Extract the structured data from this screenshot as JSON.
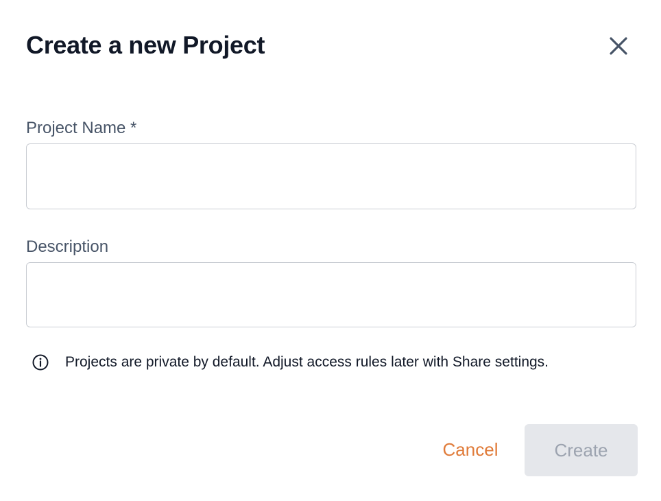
{
  "dialog": {
    "title": "Create a new Project",
    "close_icon": "close-icon"
  },
  "form": {
    "name_label": "Project Name *",
    "name_value": "",
    "description_label": "Description",
    "description_value": ""
  },
  "info": {
    "icon": "info-icon",
    "text": "Projects are private by default. Adjust access rules later with Share settings."
  },
  "actions": {
    "cancel_label": "Cancel",
    "create_label": "Create",
    "create_disabled": true
  },
  "colors": {
    "accent": "#e07b39",
    "disabled_bg": "#e5e7eb",
    "disabled_text": "#9ca3af"
  }
}
